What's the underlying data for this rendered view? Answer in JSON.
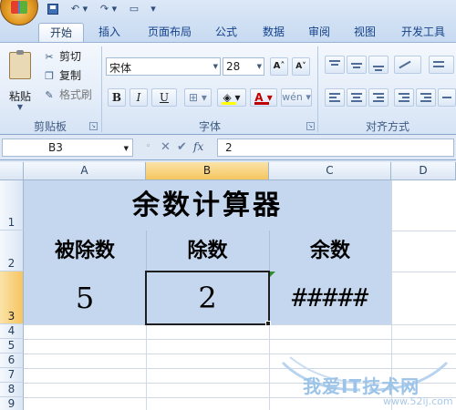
{
  "ribbon_tabs": [
    "开始",
    "插入",
    "页面布局",
    "公式",
    "数据",
    "审阅",
    "视图",
    "开发工具"
  ],
  "active_tab": "开始",
  "clipboard": {
    "paste_label": "粘贴",
    "cut_label": "剪切",
    "copy_label": "复制",
    "format_painter_label": "格式刷",
    "group_label": "剪贴板"
  },
  "font": {
    "font_name": "宋体",
    "font_size": "28",
    "group_label": "字体",
    "grow_label": "A˄",
    "shrink_label": "A˅",
    "bold_label": "B",
    "italic_label": "I",
    "underline_label": "U",
    "font_color_label": "A",
    "phonetic_label": "wén",
    "fill_color": "#ffff00",
    "font_color": "#c00000"
  },
  "alignment": {
    "group_label": "对齐方式"
  },
  "formula_bar": {
    "name_box": "B3",
    "formula": "2",
    "fx_label": "fx"
  },
  "columns": [
    "A",
    "B",
    "C",
    "D"
  ],
  "selected_column": "B",
  "rows": [
    "1",
    "2",
    "3",
    "4",
    "5",
    "6",
    "7",
    "8",
    "9"
  ],
  "selected_row": "3",
  "sheet": {
    "title": "余数计算器",
    "headers": [
      "被除数",
      "除数",
      "余数"
    ],
    "values": [
      "5",
      "2",
      "#####"
    ],
    "fill_color": "#c4d7ef"
  },
  "watermark": {
    "text": "我爱IT技术网",
    "url": "www.52ij.com"
  }
}
